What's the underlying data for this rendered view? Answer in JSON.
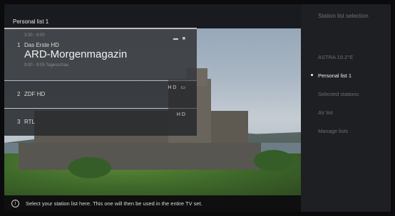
{
  "topbar": {
    "title": "Personal list 1"
  },
  "stations": [
    {
      "number": "1",
      "name": "Das Erste HD",
      "time": "3:30 - 9:00",
      "program": "ARD-Morgenmagazin",
      "next": "9:00 - 9:05 Tagesschau",
      "icons": "▬ ■",
      "selected": true
    },
    {
      "number": "2",
      "name": "ZDF HD",
      "icons": "HD ▭",
      "selected": false
    },
    {
      "number": "3",
      "name": "RTL",
      "icons": "HD",
      "selected": false
    }
  ],
  "menu": {
    "header": "Station list selection",
    "items": [
      {
        "label": "ASTRA 19.2°E",
        "selected": false
      },
      {
        "label": "Personal list 1",
        "selected": true
      },
      {
        "label": "Selected stations",
        "selected": false
      },
      {
        "label": "AV list",
        "selected": false
      },
      {
        "label": "Manage lists",
        "selected": false
      }
    ]
  },
  "info": {
    "icon": "info-icon",
    "text": "Select your station list here. This one will then be used in the entire TV set."
  },
  "colors": {
    "panel": "#1e1f23",
    "selected_text": "#f0f0f0",
    "muted_text": "#6c6d72"
  }
}
